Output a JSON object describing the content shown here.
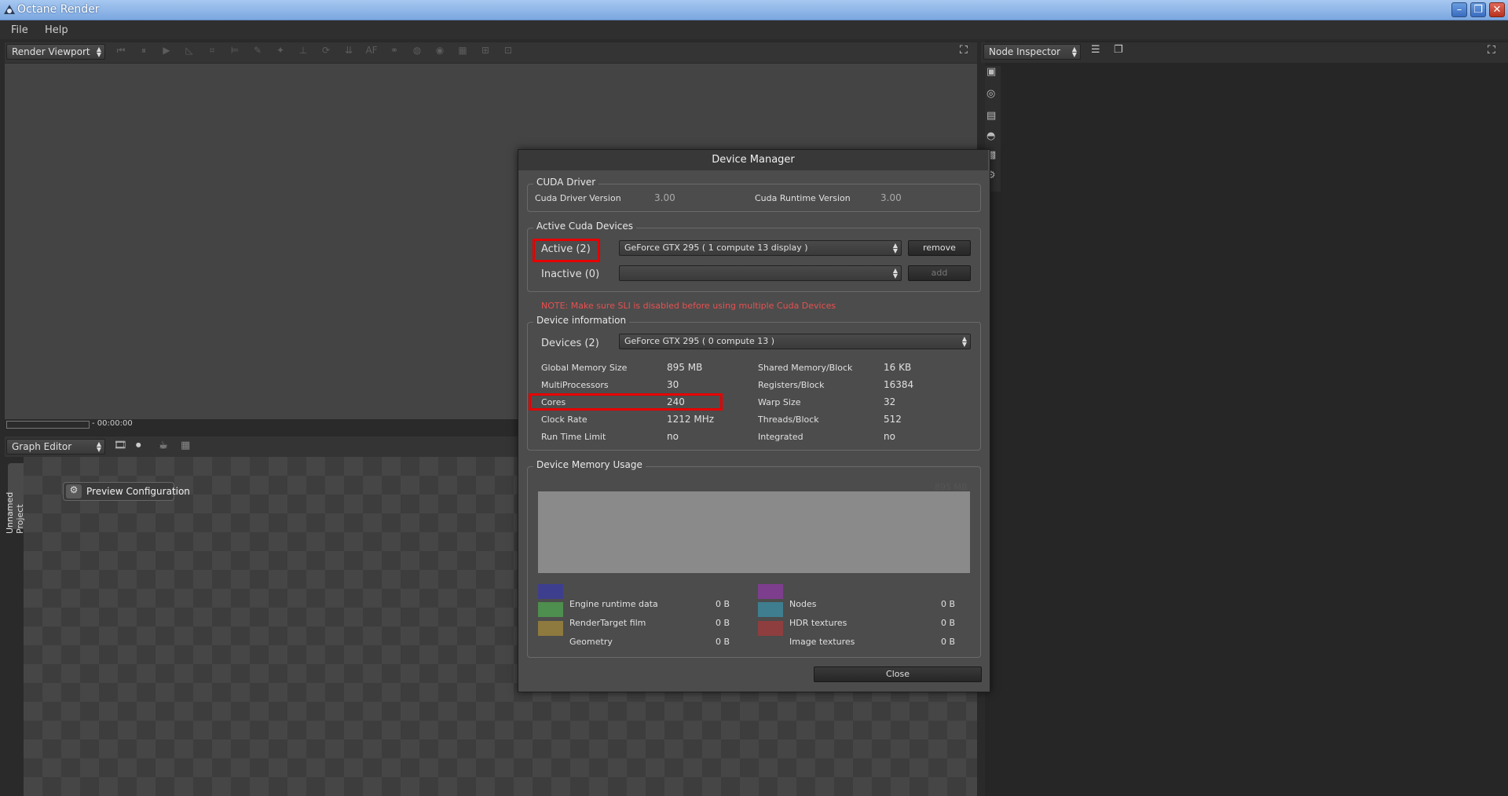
{
  "window": {
    "title": "Octane Render"
  },
  "menu": [
    "File",
    "Help"
  ],
  "viewport": {
    "selector": "Render Viewport",
    "time": "- 00:00:00",
    "toolbar_icons": [
      "skip-back-icon",
      "pause-icon",
      "play-icon",
      "ruler-icon",
      "grid-icon",
      "align-icon",
      "brush-icon",
      "highlight-icon",
      "measure-icon",
      "refresh-icon",
      "arrow-down-icon",
      "af-icon",
      "network-icon",
      "globe-icon",
      "globe-alt-icon",
      "square-icon",
      "grid-select-icon",
      "export-icon"
    ],
    "toolbar_labels": [
      "⏮",
      "⏸",
      "▶",
      "◺",
      "⌗",
      "⊨",
      "✎",
      "✦",
      "⊥",
      "⟳",
      "⇊",
      "AF",
      "⚭",
      "◍",
      "◉",
      "▦",
      "⊞",
      "⊡"
    ]
  },
  "graph_editor": {
    "selector": "Graph Editor",
    "project_tab": "Unnamed Project",
    "preview_node": "Preview Configuration"
  },
  "node_inspector": {
    "selector": "Node Inspector"
  },
  "device_manager": {
    "title": "Device Manager",
    "cuda_driver": {
      "group_title": "CUDA Driver",
      "driver_label": "Cuda Driver Version",
      "driver_value": "3.00",
      "runtime_label": "Cuda Runtime Version",
      "runtime_value": "3.00"
    },
    "active_devices": {
      "group_title": "Active Cuda Devices",
      "active_label": "Active (2)",
      "active_value": "GeForce GTX 295 ( 1 compute 13 display )",
      "remove_label": "remove",
      "inactive_label": "Inactive (0)",
      "inactive_value": "",
      "add_label": "add"
    },
    "note": "NOTE: Make sure SLI is disabled before using multiple Cuda Devices",
    "device_info": {
      "group_title": "Device information",
      "devices_label": "Devices (2)",
      "devices_value": "GeForce GTX 295 ( 0 compute 13 )",
      "rows": [
        {
          "label": "Global Memory Size",
          "value": "895 MB",
          "label2": "Shared Memory/Block",
          "value2": "16 KB"
        },
        {
          "label": "MultiProcessors",
          "value": "30",
          "label2": "Registers/Block",
          "value2": "16384"
        },
        {
          "label": "Cores",
          "value": "240",
          "label2": "Warp Size",
          "value2": "32"
        },
        {
          "label": "Clock Rate",
          "value": "1212 MHz",
          "label2": "Threads/Block",
          "value2": "512"
        },
        {
          "label": "Run Time Limit",
          "value": "no",
          "label2": "Integrated",
          "value2": "no"
        }
      ]
    },
    "memory_usage": {
      "group_title": "Device Memory Usage",
      "total": "895 MB",
      "legend": [
        {
          "label": "Engine runtime data",
          "value": "0 B",
          "color": "#3e3e8e"
        },
        {
          "label": "RenderTarget film",
          "value": "0 B",
          "color": "#4e8e4e"
        },
        {
          "label": "Geometry",
          "value": "0 B",
          "color": "#8e7a3e"
        },
        {
          "label": "Nodes",
          "value": "0 B",
          "color": "#7e3e8e"
        },
        {
          "label": "HDR textures",
          "value": "0 B",
          "color": "#3e7e8e"
        },
        {
          "label": "Image textures",
          "value": "0 B",
          "color": "#8e3e3e"
        }
      ]
    },
    "close_label": "Close"
  },
  "colors": {
    "highlight": "#e60000",
    "note": "#e85050",
    "accent_title": "#7ba7e0"
  }
}
